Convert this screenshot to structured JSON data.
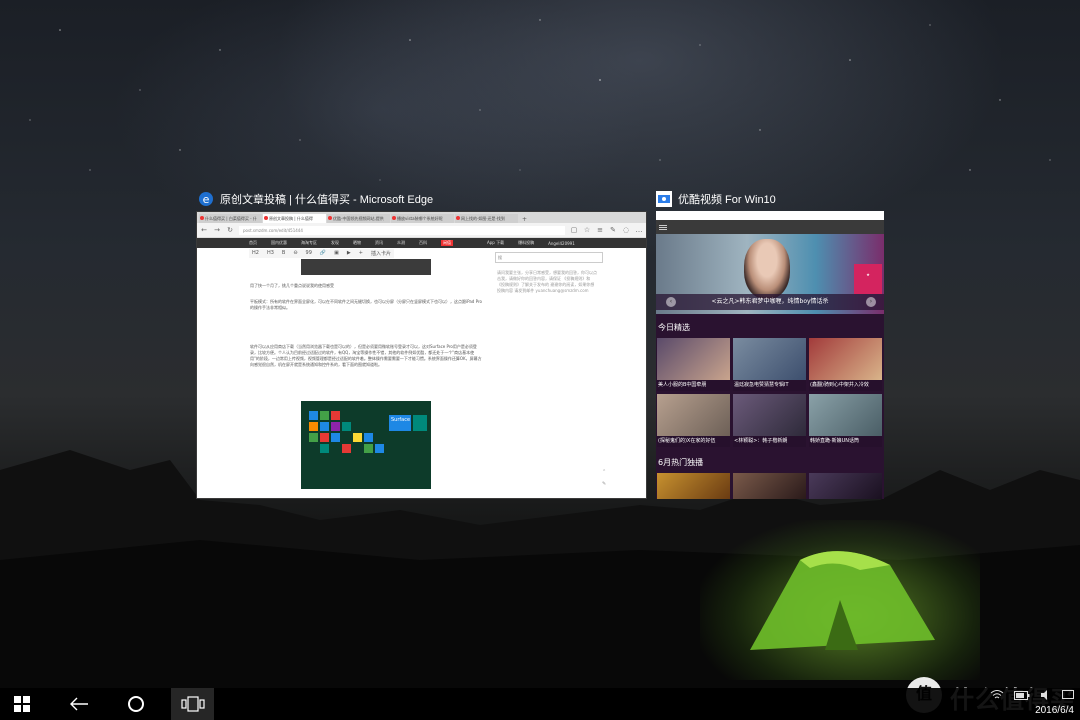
{
  "windows": {
    "edge": {
      "title": "原创文章投稿 | 什么值得买 - Microsoft Edge",
      "tabs": [
        "什么值得买 | 白菜值得买 - 什",
        "原创文章投稿 | 什么值得",
        "优酷-中国领先视频网站,提供",
        "播放vista装哪个系统好呢",
        "网上找的·如图·还是·找到"
      ],
      "url": "post.smzdm.com/edit/451444",
      "site_nav": [
        "首页",
        "国内优惠",
        "海淘专区",
        "发现",
        "晒物",
        "资讯",
        "众测",
        "百科",
        "闲值"
      ],
      "site_nav_right": [
        "App 下载",
        "爆料投稿",
        "Angel420991"
      ],
      "editor_tools": [
        "H2",
        "H3",
        "B",
        "⊖",
        "99",
        "🔗",
        "▣",
        "▶",
        "+",
        "插入卡片"
      ],
      "sidebar_search_placeholder": "搜",
      "article_para1": "用了快一个月了，挑几个重点说说我的使用感受",
      "article_para2": "平板模式：所有的软件在界面全屏化，可以在不同软件之间无缝切换，也可以分屏（分屏只在竖屏模式下也可以），这点跟iPad Pro的操作手法非常相似。",
      "article_para3": "软件可以从应用商店下载（当然用浏览器下载也是可以的），但是必须要用微软账号登录才可以，这对Surface Pro用户是必须登录，比较方便。个人认为目前经过适配过的软件，有QQ，淘宝等操作性不错，其他的软件例如优酷，都还处于一个\"商店基本使用\"的阶段，一边常用上传视频，视频管理都是经过适配的软件着。整体操作需要需要一下才能习惯。系统界面操作还算OK，屏幕方向感觉很自然，机在屏开就是系统通知和控件系的，看下面的图就知道啦。",
      "sidebar_text": "请问我要主张，分享日常感受，想要我的回答，你可以点击我，请做好你的回答内容，请保证 《投稿规则》和《投稿规则》了解关于发布的 谢谢你的阅读，如果你想投稿内容 请发到邮件 yuanchuang@smzdm.com",
      "start_tile_label": "Surface"
    },
    "youku": {
      "title": "优酷视频 For Win10",
      "banner_caption": "<云之凡>韩东君梦中咖喱，纯情boy情话杀",
      "section_today": "今日精选",
      "section_june": "6月热门独播",
      "cards": [
        "美人小服的B中国牵朋",
        "温廷寂急电赞猜慧专辑IT",
        "(鑫翻)骑到心中架并入冷效",
        "(探秘鬼们的)X在家的好伍",
        "<林颖聪>：韩子楷新朗",
        "韩娇直跪·新娘UN话筒"
      ]
    }
  },
  "taskbar": {
    "clock_date": "2016/6/4",
    "icons": [
      "windows-start-icon",
      "back-arrow-icon",
      "cortana-circle-icon",
      "task-view-icon"
    ]
  },
  "watermark": {
    "logo_char": "值",
    "text": "什么值得买"
  },
  "colors": {
    "edge_blue": "#1e6fd0",
    "youku_purple": "#2a1230",
    "taskbar": "#000000"
  }
}
